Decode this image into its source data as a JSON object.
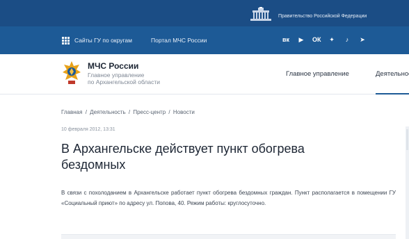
{
  "gov_bar": {
    "link_label": "Правительство Российской Федерации",
    "icon": "government-building-icon"
  },
  "nav_bar": {
    "menu_icon": "grid-menu-icon",
    "sites_label": "Сайты ГУ по округам",
    "portal_label": "Портал МЧС России",
    "socials": [
      {
        "name": "vk-icon",
        "glyph": "вк"
      },
      {
        "name": "youtube-icon",
        "glyph": "▶"
      },
      {
        "name": "odnoklassniki-icon",
        "glyph": "ОК"
      },
      {
        "name": "twitter-icon",
        "glyph": "✦"
      },
      {
        "name": "tiktok-icon",
        "glyph": "♪"
      },
      {
        "name": "telegram-icon",
        "glyph": "➤"
      }
    ]
  },
  "header": {
    "logo_icon": "emchs-emblem-icon",
    "org_title": "МЧС России",
    "org_subtitle_line1": "Главное управление",
    "org_subtitle_line2": "по Архангельской области",
    "nav_main": "Главное управление",
    "nav_activity": "Деятельность"
  },
  "article": {
    "breadcrumb": [
      "Главная",
      "Деятельность",
      "Пресс-центр",
      "Новости"
    ],
    "breadcrumb_separator": "/",
    "date": "10 февраля 2012, 13:31",
    "title": "В Архангельске действует пункт обогрева бездомных",
    "body": "В связи с похолоданием в Архангельске работает пункт обогрева бездомных граждан. Пункт располагается в помещении ГУ «Социальный приют» по адресу ул. Попова, 40. Режим работы: круглосуточно."
  },
  "colors": {
    "gov_bar": "#1b4d85",
    "nav_bar": "#1d5a96",
    "accent": "#1d5a96"
  }
}
